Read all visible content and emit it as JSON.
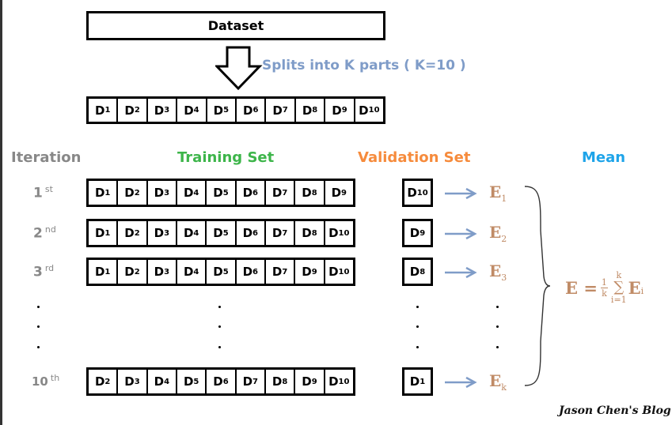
{
  "dataset_label": "Dataset",
  "split_label": "Splits into K parts ( K=10 )",
  "parts": [
    "1",
    "2",
    "3",
    "4",
    "5",
    "6",
    "7",
    "8",
    "9",
    "10"
  ],
  "headers": {
    "iteration": "Iteration",
    "training": "Training Set",
    "validation": "Validation Set",
    "mean": "Mean"
  },
  "colors": {
    "training": "#3db54a",
    "validation": "#f68b3c",
    "mean": "#1ea4e9",
    "split": "#7f9cc8",
    "error": "#c08b66",
    "iteration": "#888888"
  },
  "rows": [
    {
      "num": "1",
      "suffix": "st",
      "train": [
        "1",
        "2",
        "3",
        "4",
        "5",
        "6",
        "7",
        "8",
        "9"
      ],
      "val": "10",
      "error": "1"
    },
    {
      "num": "2",
      "suffix": "nd",
      "train": [
        "1",
        "2",
        "3",
        "4",
        "5",
        "6",
        "7",
        "8",
        "10"
      ],
      "val": "9",
      "error": "2"
    },
    {
      "num": "3",
      "suffix": "rd",
      "train": [
        "1",
        "2",
        "3",
        "4",
        "5",
        "6",
        "7",
        "9",
        "10"
      ],
      "val": "8",
      "error": "3"
    },
    {
      "num": "10",
      "suffix": "th",
      "train": [
        "2",
        "3",
        "4",
        "5",
        "6",
        "7",
        "8",
        "9",
        "10"
      ],
      "val": "1",
      "error": "k"
    }
  ],
  "formula": {
    "lhs": "E =",
    "num": "1",
    "den": "k",
    "upper": "k",
    "sigma": "∑",
    "lower": "i=1",
    "term": "E",
    "sub": "i"
  },
  "signature": "Jason Chen's Blog"
}
